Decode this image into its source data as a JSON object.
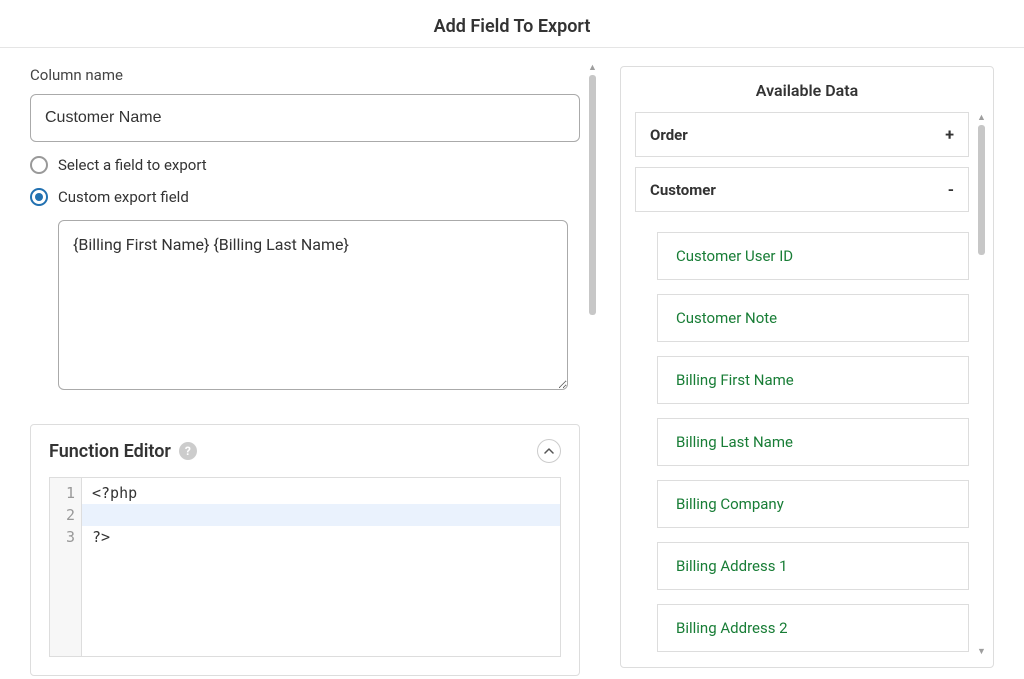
{
  "modal": {
    "title": "Add Field To Export"
  },
  "left": {
    "column_name_label": "Column name",
    "column_name_value": "Customer Name",
    "radio_select_label": "Select a field to export",
    "radio_custom_label": "Custom export field",
    "custom_field_value": "{Billing First Name} {Billing Last Name}"
  },
  "fn_editor": {
    "title": "Function Editor",
    "lines": [
      "<?php",
      "",
      "?>"
    ],
    "line_numbers": [
      "1",
      "2",
      "3"
    ]
  },
  "available": {
    "title": "Available Data",
    "groups": [
      {
        "name": "Order",
        "expanded": false
      },
      {
        "name": "Customer",
        "expanded": true
      }
    ],
    "customer_fields": [
      "Customer User ID",
      "Customer Note",
      "Billing First Name",
      "Billing Last Name",
      "Billing Company",
      "Billing Address 1",
      "Billing Address 2"
    ]
  }
}
